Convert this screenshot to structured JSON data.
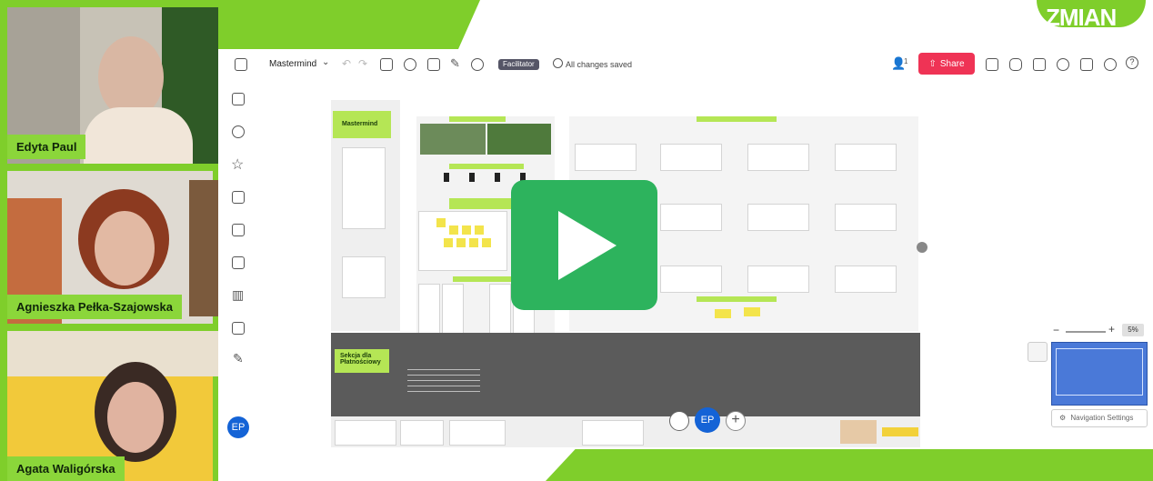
{
  "brand": {
    "logo_text": "ZMIAN"
  },
  "participants": [
    {
      "name": "Edyta Paul"
    },
    {
      "name": "Agnieszka Pełka-Szajowska"
    },
    {
      "name": "Agata Waligórska"
    }
  ],
  "board": {
    "title": "Mastermind",
    "facilitator_label": "Facilitator",
    "save_status": "All changes saved",
    "share_label": "Share",
    "collab_count": "1",
    "user_initials": "EP",
    "zoom_level": "5%",
    "nav_settings_label": "Navigation Settings",
    "frame_title": "Mastermind",
    "section_label": "Sekcja dla Płatnościowy"
  },
  "colors": {
    "brand_green": "#7fce2b",
    "share_red": "#ef3355",
    "play_green": "#2db35d",
    "avatar_blue": "#1463d6"
  }
}
